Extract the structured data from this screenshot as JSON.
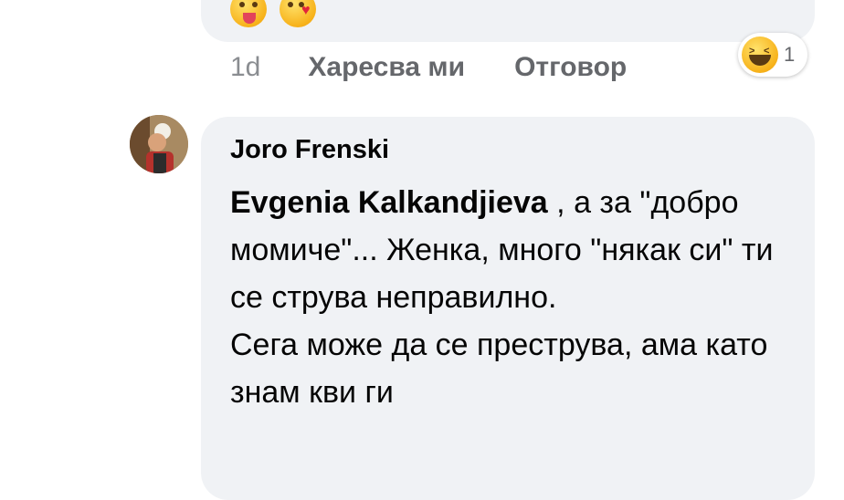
{
  "previous_comment": {
    "emojis": [
      "winking-tongue-emoji",
      "kissing-heart-emoji"
    ],
    "time": "1d",
    "like_label": "Харесва ми",
    "reply_label": "Отговор",
    "reaction": {
      "icon": "haha-reaction",
      "count": "1"
    }
  },
  "comment": {
    "author": "Joro Frenski",
    "mention": "Evgenia Kalkandjieva",
    "text_after_mention": " , а за \"добро момиче\"... Женка, много \"някак си\" ти се струва неправилно.",
    "text_second": "Сега може да се преструва, ама като знам кви ги"
  }
}
